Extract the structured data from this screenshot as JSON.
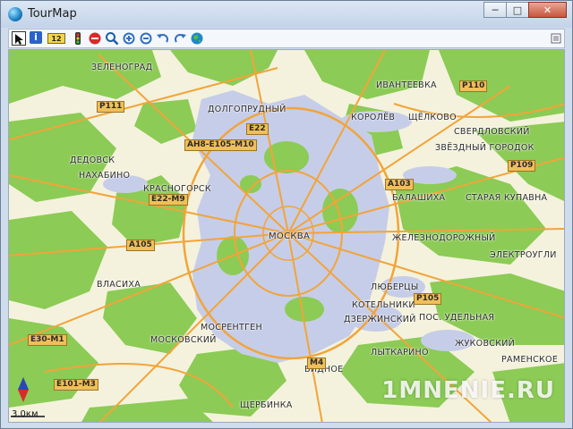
{
  "window": {
    "title": "TourMap"
  },
  "titlebar": {
    "minimize_icon": "minimize-icon",
    "maximize_icon": "maximize-icon",
    "close_icon": "close-icon"
  },
  "toolbar": {
    "items": [
      "pointer-tool-icon",
      "info-tool-icon",
      "label-tool-icon",
      "traffic-light-icon",
      "stop-icon",
      "search-icon",
      "zoom-in-icon",
      "zoom-out-icon",
      "undo-icon",
      "redo-icon",
      "globe-icon",
      "menu-icon"
    ],
    "info_glyph": "i",
    "label_glyph": "12"
  },
  "map": {
    "cities": [
      {
        "text": "ЗЕЛЕНОГРАД"
      },
      {
        "text": "ДОЛГОПРУДНЫЙ"
      },
      {
        "text": "ДЕДОВСК"
      },
      {
        "text": "НАХАБИНО"
      },
      {
        "text": "КРАСНОГОРСК"
      },
      {
        "text": "ИВАНТЕЕВКА"
      },
      {
        "text": "КОРОЛЁВ"
      },
      {
        "text": "ЩЁЛКОВО"
      },
      {
        "text": "СВЕРДЛОВСКИЙ"
      },
      {
        "text": "ЗВЁЗДНЫЙ ГОРОДОК"
      },
      {
        "text": "БАЛАШИХА"
      },
      {
        "text": "СТАРАЯ КУПАВНА"
      },
      {
        "text": "МОСКВА"
      },
      {
        "text": "ЖЕЛЕЗНОДОРОЖНЫЙ"
      },
      {
        "text": "ЭЛЕКТРОУГЛИ"
      },
      {
        "text": "ВЛАСИХА"
      },
      {
        "text": "ЛЮБЕРЦЫ"
      },
      {
        "text": "КОТЕЛЬНИКИ"
      },
      {
        "text": "ДЗЕРЖИНСКИЙ"
      },
      {
        "text": "ПОС. УДЕЛЬНАЯ"
      },
      {
        "text": "МОСРЕНТГЕН"
      },
      {
        "text": "МОСКОВСКИЙ"
      },
      {
        "text": "ЖУКОВСКИЙ"
      },
      {
        "text": "ЛЫТКАРИНО"
      },
      {
        "text": "РАМЕНСКОЕ"
      },
      {
        "text": "ВИДНОЕ"
      },
      {
        "text": "ЩЕРБИНКА"
      }
    ],
    "roads": [
      {
        "text": "Р111"
      },
      {
        "text": "АН8-Е105-М10"
      },
      {
        "text": "Е22"
      },
      {
        "text": "Р110"
      },
      {
        "text": "А103"
      },
      {
        "text": "Р109"
      },
      {
        "text": "Е22-М9"
      },
      {
        "text": "А105"
      },
      {
        "text": "Р105"
      },
      {
        "text": "Е30-М1"
      },
      {
        "text": "М4"
      },
      {
        "text": "Е101-М3"
      }
    ],
    "scale": "3.0км",
    "compass_icon": "compass-icon",
    "watermark": "1MNENIE.RU"
  },
  "colors": {
    "urban": "#c6cde8",
    "forest": "#8ccb55",
    "field": "#f4f2dd",
    "road": "#f2a43a",
    "badge": "#f0bf59",
    "window": "#cfdcec"
  }
}
